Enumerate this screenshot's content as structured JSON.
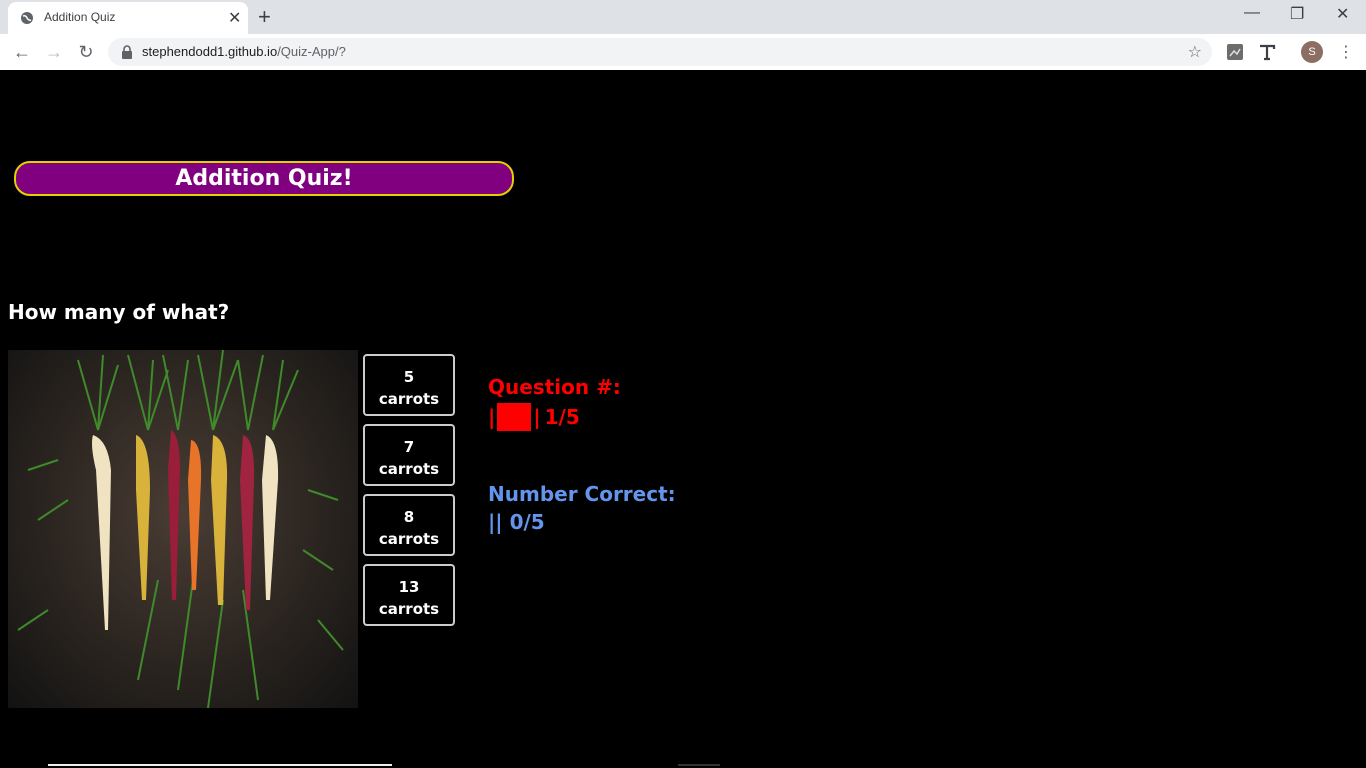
{
  "browser": {
    "tab_title": "Addition Quiz",
    "url_host": "stephendodd1.github.io",
    "url_path": "/Quiz-App/?",
    "avatar_letter": "S"
  },
  "quiz": {
    "title": "Addition Quiz!",
    "question": "How many of what?",
    "answers": [
      {
        "line1": "5",
        "line2": "carrots"
      },
      {
        "line1": "7",
        "line2": "carrots"
      },
      {
        "line1": "8",
        "line2": "carrots"
      },
      {
        "line1": "13",
        "line2": "carrots"
      }
    ],
    "question_label": "Question #:",
    "question_progress": "1/5",
    "question_fraction": 0.2,
    "correct_label": "Number Correct:",
    "correct_progress": "0/5",
    "correct_fraction": 0
  },
  "colors": {
    "banner_bg": "#800080",
    "banner_border": "#e5d000",
    "question_color": "#ff0000",
    "correct_color": "#6495ed"
  }
}
